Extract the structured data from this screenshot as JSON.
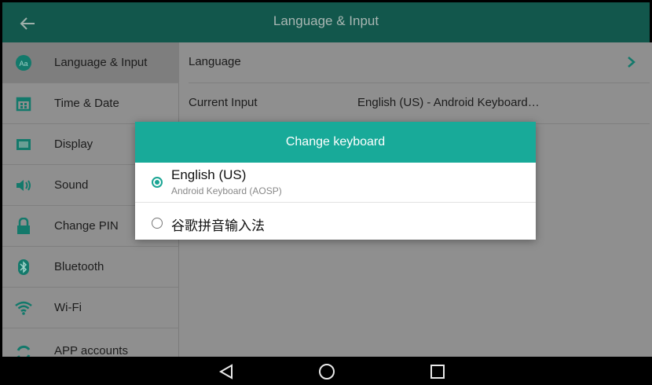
{
  "topbar": {
    "title": "Language & Input",
    "back_icon": "arrow-left-icon"
  },
  "sidebar": {
    "items": [
      {
        "label": "Language & Input",
        "icon": "language-icon",
        "active": true
      },
      {
        "label": "Time & Date",
        "icon": "calendar-icon"
      },
      {
        "label": "Display",
        "icon": "display-icon"
      },
      {
        "label": "Sound",
        "icon": "speaker-icon"
      },
      {
        "label": "Change PIN",
        "icon": "lock-icon"
      },
      {
        "label": "Bluetooth",
        "icon": "bluetooth-icon"
      },
      {
        "label": "Wi-Fi",
        "icon": "wifi-icon"
      },
      {
        "label": "APP accounts",
        "icon": "sync-icon"
      }
    ]
  },
  "content": {
    "rows": [
      {
        "label": "Language",
        "value": ""
      },
      {
        "label": "Current Input",
        "value": "English (US) - Android Keyboard…"
      }
    ]
  },
  "dialog": {
    "title": "Change keyboard",
    "options": [
      {
        "title": "English (US)",
        "subtitle": "Android Keyboard (AOSP)",
        "selected": true
      },
      {
        "title": "谷歌拼音输入法",
        "subtitle": "",
        "selected": false
      }
    ]
  },
  "navbar": {
    "back": "back-triangle-icon",
    "home": "home-circle-icon",
    "recents": "recents-square-icon"
  },
  "colors": {
    "accent": "#18aa99",
    "topbar": "#12574c",
    "overlay_bg": "#8f8f8f"
  }
}
